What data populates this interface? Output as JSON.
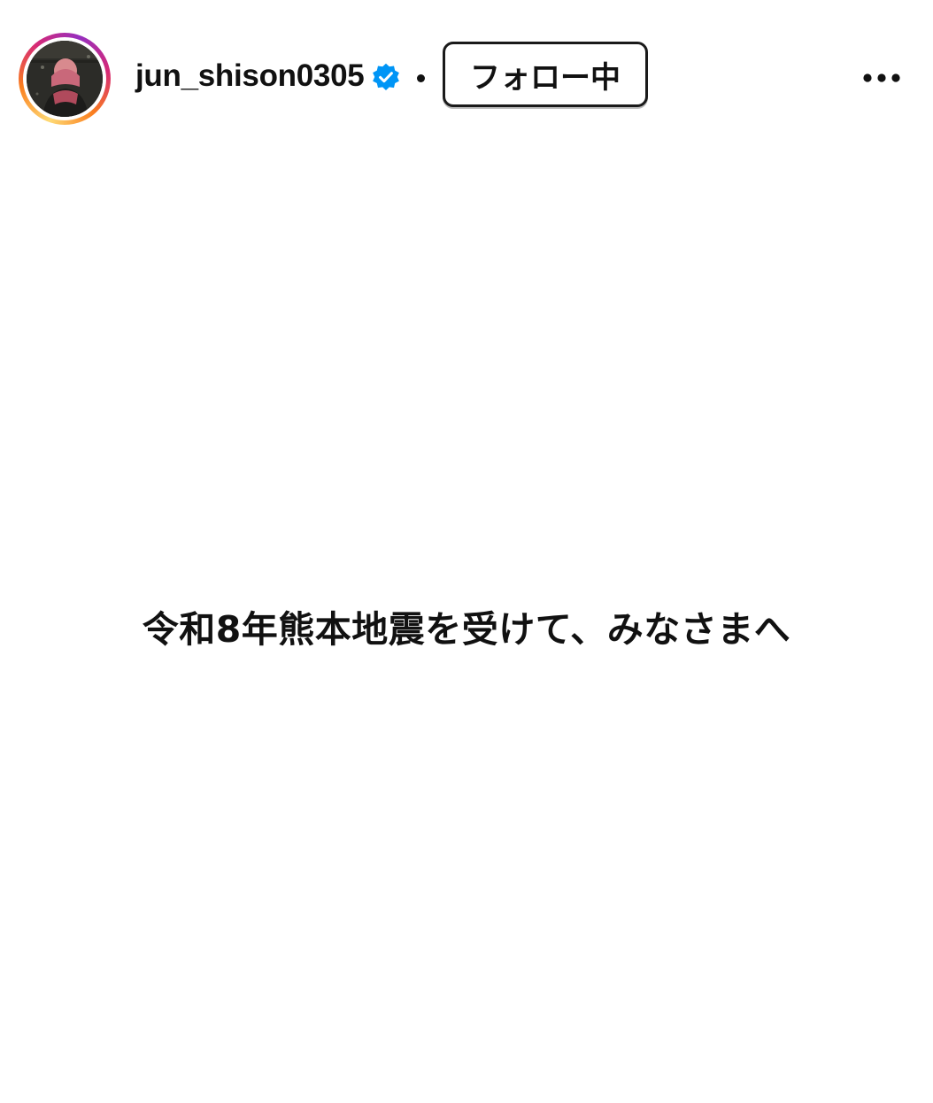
{
  "header": {
    "username": "jun_shison0305",
    "separator": "•",
    "follow_label": "フォロー中",
    "verified": true,
    "icons": {
      "avatar": "profile-photo",
      "verified": "verified-badge-icon",
      "more": "more-options-icon"
    },
    "colors": {
      "verified": "#0095f6",
      "ring_start": "#feda75",
      "ring_end": "#962fbf"
    }
  },
  "post": {
    "text": "令和8年熊本地震を受けて、みなさまへ",
    "background": "#ffffff"
  }
}
